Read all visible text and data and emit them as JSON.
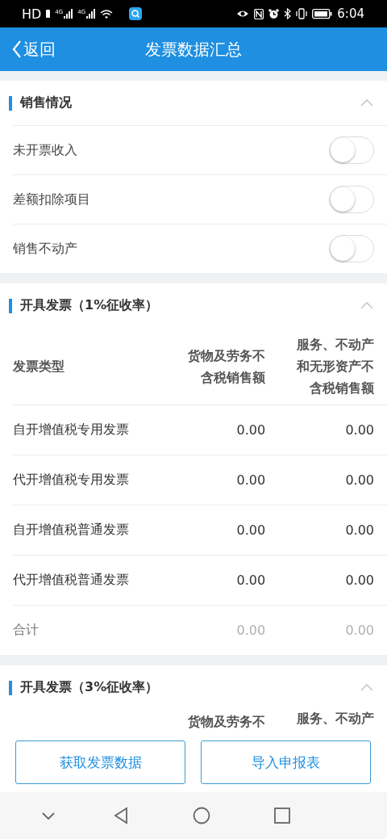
{
  "status_bar": {
    "hd": "HD",
    "signals": [
      "4G",
      "4G"
    ],
    "time": "6:04"
  },
  "header": {
    "back": "返回",
    "title": "发票数据汇总"
  },
  "sales": {
    "title": "销售情况",
    "expanded": true,
    "rows": [
      {
        "label": "未开票收入",
        "on": false
      },
      {
        "label": "差额扣除项目",
        "on": false
      },
      {
        "label": "销售不动产",
        "on": false
      }
    ]
  },
  "invoices_1pct": {
    "title": "开具发票（1%征收率）",
    "expanded": true,
    "columns": [
      "发票类型",
      "货物及劳务不含税销售额",
      "服务、不动产和无形资产不含税销售额"
    ],
    "rows": [
      {
        "kind": "item",
        "cells": [
          "自开增值税专用发票",
          "0.00",
          "0.00"
        ]
      },
      {
        "kind": "item",
        "cells": [
          "代开增值税专用发票",
          "0.00",
          "0.00"
        ]
      },
      {
        "kind": "item",
        "cells": [
          "自开增值税普通发票",
          "0.00",
          "0.00"
        ]
      },
      {
        "kind": "item",
        "cells": [
          "代开增值税普通发票",
          "0.00",
          "0.00"
        ]
      },
      {
        "kind": "total",
        "cells": [
          "合计",
          "0.00",
          "0.00"
        ]
      }
    ]
  },
  "invoices_3pct": {
    "title": "开具发票（3%征收率）",
    "expanded": true,
    "columns": [
      "货物及劳务不",
      "服务、不动产"
    ]
  },
  "buttons": [
    "获取发票数据",
    "导入申报表"
  ]
}
